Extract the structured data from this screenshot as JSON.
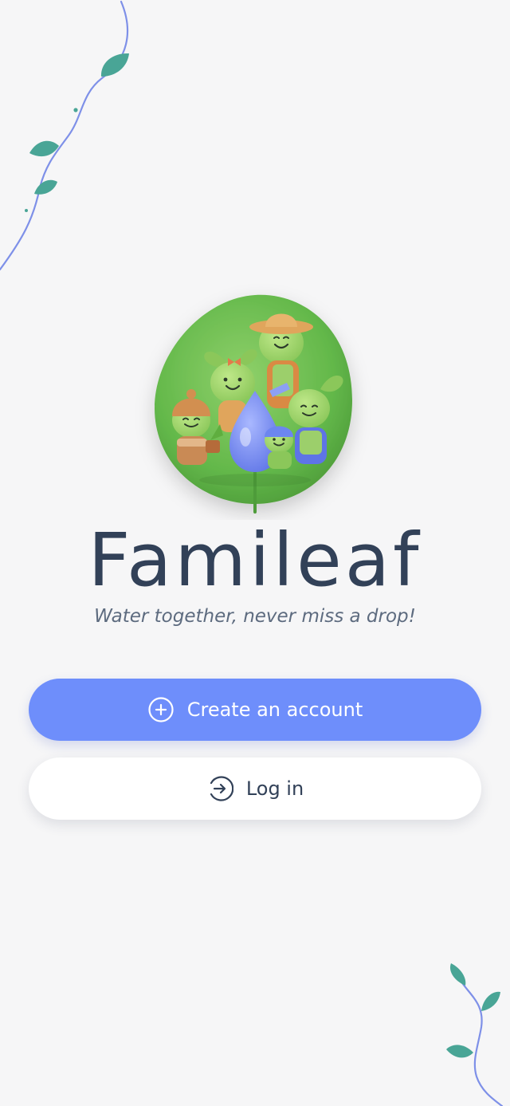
{
  "app": {
    "name": "Famileaf",
    "tagline": "Water together, never miss a drop!"
  },
  "actions": {
    "create_account_label": "Create an account",
    "login_label": "Log in"
  },
  "icons": {
    "create_account": "plus-circle-icon",
    "login": "arrow-right-circle-icon"
  },
  "colors": {
    "background": "#f6f6f7",
    "primary": "#6e8efb",
    "text_dark": "#324158",
    "leaf_green": "#49a596",
    "vine_blue": "#7e90e8"
  }
}
